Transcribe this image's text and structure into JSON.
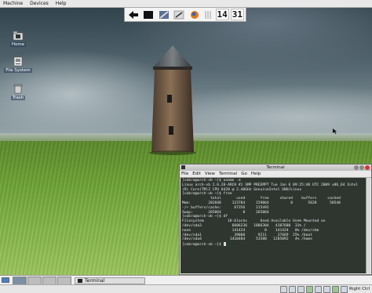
{
  "host_menu": {
    "items": [
      "Machine",
      "Devices",
      "Help"
    ]
  },
  "desktop_icons": [
    {
      "label": "Home",
      "icon": "home-folder-icon"
    },
    {
      "label": "File System",
      "icon": "drive-icon"
    },
    {
      "label": "Trash",
      "icon": "trash-icon"
    }
  ],
  "top_panel": {
    "launchers": [
      "run-icon",
      "terminal-icon",
      "tools-icon",
      "globe-icon"
    ],
    "clock_hours": "14",
    "clock_minutes": "31"
  },
  "terminal": {
    "title": "Terminal",
    "menu": [
      "File",
      "Edit",
      "View",
      "Terminal",
      "Go",
      "Help"
    ],
    "lines": [
      "[cobra@arch-vb ~]$ uname -a",
      "Linux arch-vb 2.6.28-ARCH #1 SMP PREEMPT Tue Jan 6 09:25:48 UTC 2009 x86_64 Intel",
      "(R) Core(TM)2 CPU 6420 @ 2.40GHz GenuineIntel GNU/Linux",
      "[cobra@arch-vb ~]$ free",
      "             total       used       free     shared    buffers     cached",
      "Mem:        282848     123784     159064          0       5828      50540",
      "-/+ buffers/cache:      67356     215492",
      "Swap:       265064          0     265064",
      "[cobra@arch-vb ~]$ df",
      "Filesystem           1K-blocks      Used Available Use% Mounted on",
      "/dev/sda3              6606236   1886304   4387680  31% /",
      "none                   141424         0    141424   0% /dev/shm",
      "/dev/sda1               39080      9211     27669  25% /boot",
      "/dev/sda4             1410484     53580   1285092   4% /home",
      "[cobra@arch-vb ~]$ "
    ]
  },
  "taskbar": {
    "task_label": "Terminal"
  },
  "host_status": {
    "hostkey": "Right Ctrl"
  }
}
